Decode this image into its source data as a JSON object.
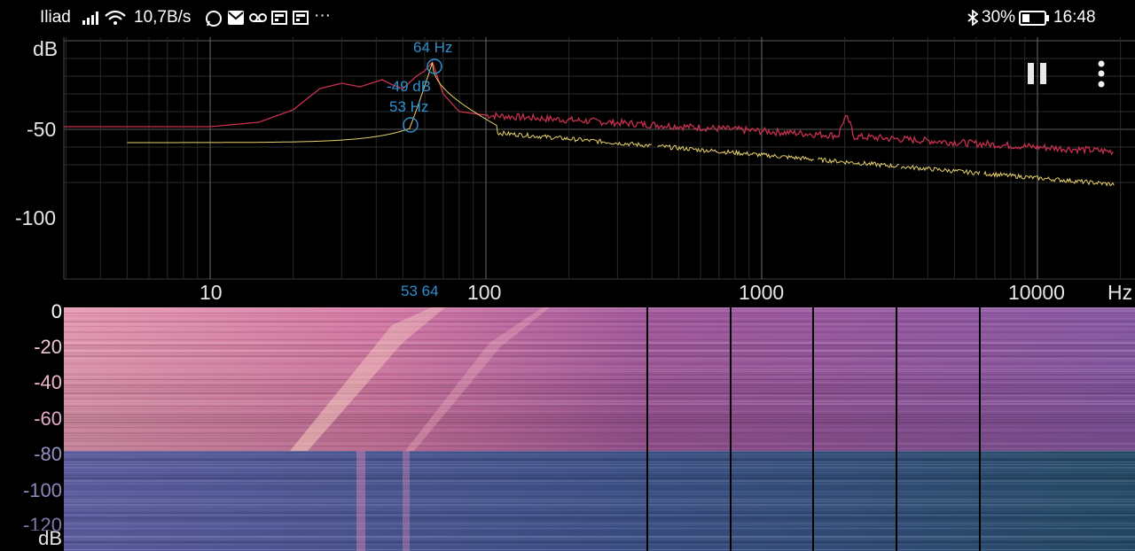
{
  "status_bar": {
    "carrier": "Iliad",
    "net_speed": "10,7B/s",
    "notification_icons": [
      "whatsapp-icon",
      "mail-icon",
      "voicemail-icon",
      "news-icon",
      "news-icon"
    ],
    "more": "···",
    "battery": "30%",
    "time": "16:48"
  },
  "spectrum": {
    "y_unit": "dB",
    "y_ticks": [
      "-50",
      "-100"
    ],
    "x_ticks": [
      "10",
      "100",
      "1000",
      "10000"
    ],
    "x_unit": "Hz",
    "peak_label": "64 Hz",
    "cursor_db": "-49 dB",
    "cursor_freq": "53 Hz",
    "marker_labels": "53 64",
    "colors": {
      "peak_trace": "#c8304e",
      "live_trace": "#e9d36b",
      "annotation": "#2f8fd0"
    }
  },
  "controls": {
    "pause_icon": "pause-icon",
    "menu_icon": "more-vert-icon"
  },
  "spectrogram": {
    "y_ticks": [
      "0",
      "-20",
      "-40",
      "-60",
      "-80",
      "-100",
      "-120"
    ],
    "y_unit": "dB",
    "colors": {
      "hot": "#f3c6c4",
      "mid": "#b7569a",
      "cold": "#1f3d55"
    }
  }
}
